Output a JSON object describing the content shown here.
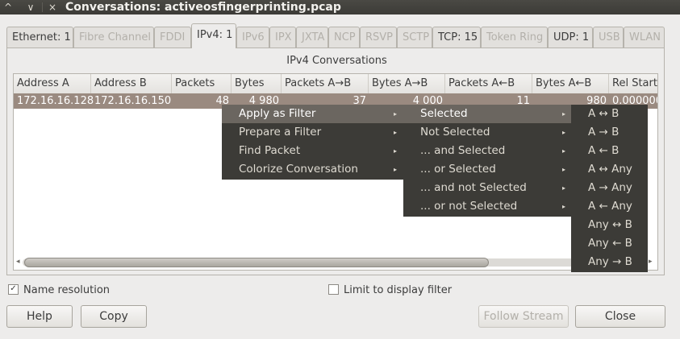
{
  "window": {
    "title": "Conversations: activeosfingerprinting.pcap",
    "controls": [
      "^",
      "∨",
      "×"
    ]
  },
  "tabs": [
    {
      "label": "Ethernet: 1",
      "enabled": true
    },
    {
      "label": "Fibre Channel",
      "enabled": false
    },
    {
      "label": "FDDI",
      "enabled": false
    },
    {
      "label": "IPv4: 1",
      "enabled": true,
      "active": true
    },
    {
      "label": "IPv6",
      "enabled": false
    },
    {
      "label": "IPX",
      "enabled": false
    },
    {
      "label": "JXTA",
      "enabled": false
    },
    {
      "label": "NCP",
      "enabled": false
    },
    {
      "label": "RSVP",
      "enabled": false
    },
    {
      "label": "SCTP",
      "enabled": false
    },
    {
      "label": "TCP: 15",
      "enabled": true
    },
    {
      "label": "Token Ring",
      "enabled": false
    },
    {
      "label": "UDP: 1",
      "enabled": true
    },
    {
      "label": "USB",
      "enabled": false
    },
    {
      "label": "WLAN",
      "enabled": false
    }
  ],
  "panel_title": "IPv4 Conversations",
  "table": {
    "columns": [
      "Address A",
      "Address B",
      "Packets",
      "Bytes",
      "Packets A→B",
      "Bytes A→B",
      "Packets A←B",
      "Bytes A←B",
      "Rel Start"
    ],
    "rows": [
      [
        "172.16.16.128",
        "172.16.16.150",
        "48",
        "4 980",
        "37",
        "4 000",
        "11",
        "980",
        "0.000000"
      ]
    ]
  },
  "scroll": {
    "left_arrow": "◂",
    "right_arrow": "▸"
  },
  "menus": {
    "main": [
      {
        "label": "Apply as Filter",
        "arrow": "▸",
        "highlighted": true
      },
      {
        "label": "Prepare a Filter",
        "arrow": "▸"
      },
      {
        "label": "Find Packet",
        "arrow": "▸"
      },
      {
        "label": "Colorize Conversation",
        "arrow": "▸"
      }
    ],
    "filter": [
      {
        "label": "Selected",
        "arrow": "▸",
        "highlighted": true
      },
      {
        "label": "Not Selected",
        "arrow": "▸"
      },
      {
        "label": "... and Selected",
        "arrow": "▸"
      },
      {
        "label": "... or Selected",
        "arrow": "▸"
      },
      {
        "label": "... and not Selected",
        "arrow": "▸"
      },
      {
        "label": "... or not Selected",
        "arrow": "▸"
      }
    ],
    "direction": [
      "A ↔ B",
      "A → B",
      "A ← B",
      "A ↔ Any",
      "A → Any",
      "A ← Any",
      "Any ↔ B",
      "Any ← B",
      "Any → B"
    ]
  },
  "options": {
    "name_resolution": {
      "label": "Name resolution",
      "checked": true,
      "mark": "✓"
    },
    "limit_filter": {
      "label": "Limit to display filter",
      "checked": false
    }
  },
  "buttons": {
    "help": "Help",
    "copy": "Copy",
    "follow_stream": "Follow Stream",
    "close": "Close"
  }
}
